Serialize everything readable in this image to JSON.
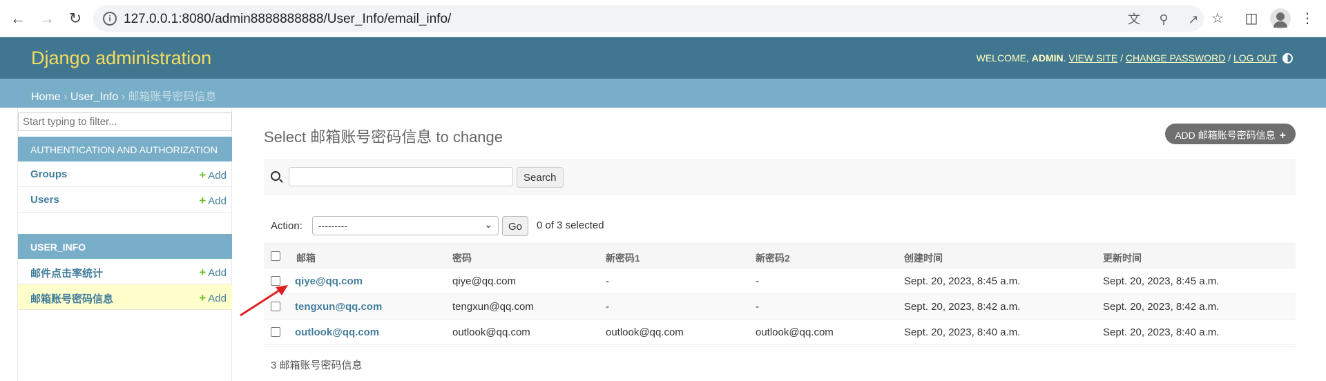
{
  "browser": {
    "url": "127.0.0.1:8080/admin8888888888/User_Info/email_info/",
    "back_icon": "arrow-left-icon",
    "forward_icon": "arrow-right-icon",
    "reload_icon": "reload-icon"
  },
  "header": {
    "branding": "Django administration",
    "welcome": "WELCOME, ",
    "username": "ADMIN",
    "view_site": "VIEW SITE",
    "change_password": "CHANGE PASSWORD",
    "logout": "LOG OUT",
    "sep": " / "
  },
  "breadcrumbs": {
    "home": "Home",
    "app": "User_Info",
    "current": "邮箱账号密码信息",
    "sep": " › "
  },
  "sidebar": {
    "filter_placeholder": "Start typing to filter...",
    "apps": [
      {
        "caption": "AUTHENTICATION AND AUTHORIZATION",
        "models": [
          {
            "name": "Groups",
            "add": "Add"
          },
          {
            "name": "Users",
            "add": "Add"
          }
        ]
      },
      {
        "caption": "USER_INFO",
        "models": [
          {
            "name": "邮件点击率统计",
            "add": "Add"
          },
          {
            "name": "邮箱账号密码信息",
            "add": "Add"
          }
        ]
      }
    ]
  },
  "main": {
    "title": "Select 邮箱账号密码信息 to change",
    "add_button": "ADD 邮箱账号密码信息",
    "search_button": "Search",
    "action_label": "Action:",
    "action_selected": "---------",
    "go_button": "Go",
    "selected_count": "0 of 3 selected",
    "columns": [
      "邮箱",
      "密码",
      "新密码1",
      "新密码2",
      "创建时间",
      "更新时间"
    ],
    "rows": [
      [
        "qiye@qq.com",
        "qiye@qq.com",
        "-",
        "-",
        "Sept. 20, 2023, 8:45 a.m.",
        "Sept. 20, 2023, 8:45 a.m."
      ],
      [
        "tengxun@qq.com",
        "tengxun@qq.com",
        "-",
        "-",
        "Sept. 20, 2023, 8:42 a.m.",
        "Sept. 20, 2023, 8:42 a.m."
      ],
      [
        "outlook@qq.com",
        "outlook@qq.com",
        "outlook@qq.com",
        "outlook@qq.com",
        "Sept. 20, 2023, 8:40 a.m.",
        "Sept. 20, 2023, 8:40 a.m."
      ]
    ],
    "paginator": "3 邮箱账号密码信息"
  },
  "colors": {
    "header_bg": "#417690",
    "breadcrumb_bg": "#79aec8",
    "branding": "#f5dd5d",
    "link": "#447e9b",
    "add_plus": "#70bf2b",
    "current_row_bg": "#ffffcc",
    "annotation_arrow": "#e02020"
  }
}
